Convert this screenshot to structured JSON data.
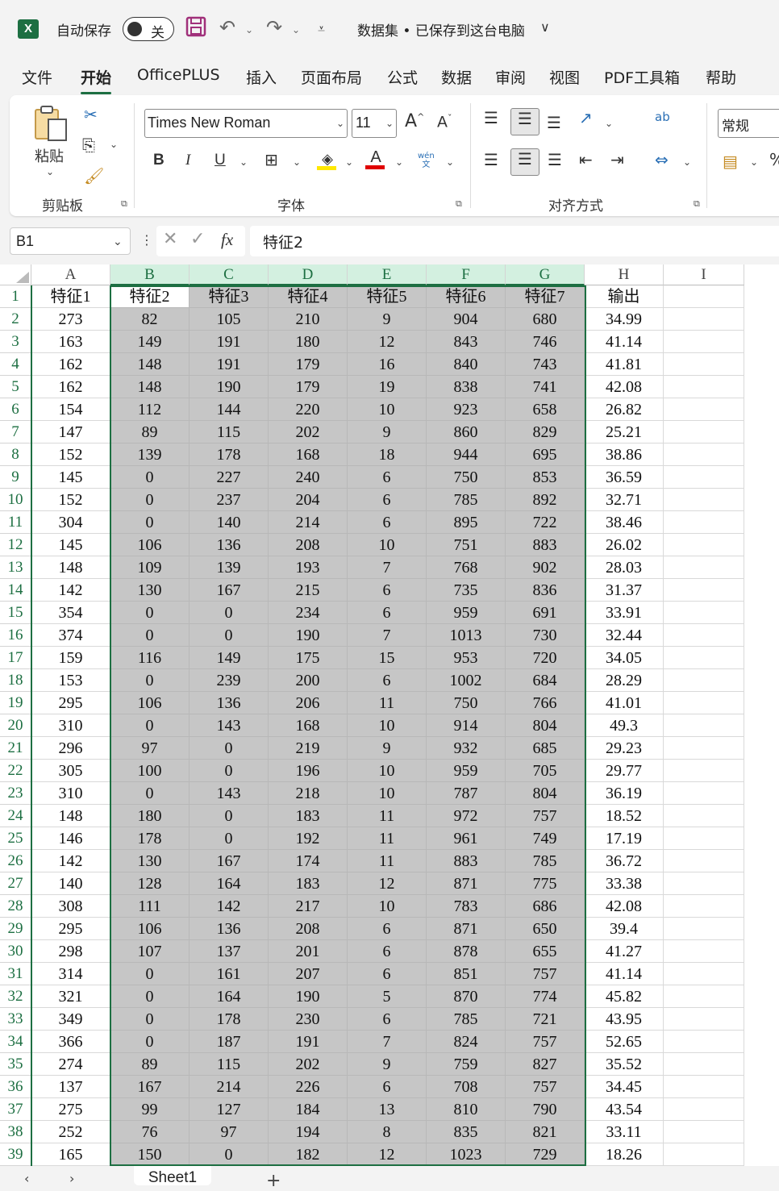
{
  "titlebar": {
    "autosave_label": "自动保存",
    "autosave_state": "关",
    "doc_title": "数据集 • 已保存到这台电脑"
  },
  "menu": {
    "tabs": [
      "文件",
      "开始",
      "OfficePLUS",
      "插入",
      "页面布局",
      "公式",
      "数据",
      "审阅",
      "视图",
      "PDF工具箱",
      "帮助"
    ],
    "active": "开始"
  },
  "ribbon": {
    "clipboard": {
      "paste_label": "粘贴",
      "group_label": "剪贴板"
    },
    "font": {
      "font_name": "Times New Roman",
      "font_size": "11",
      "group_label": "字体",
      "bold": "B",
      "italic": "I",
      "underline": "U",
      "font_color_letter": "A",
      "phonetic_top": "wén",
      "phonetic_bottom": "文"
    },
    "alignment": {
      "group_label": "对齐方式",
      "wrap_icon_text": "ab"
    },
    "number": {
      "format": "常规"
    }
  },
  "formula_bar": {
    "name_box": "B1",
    "fx_label": "fx",
    "formula": "特征2"
  },
  "sheet": {
    "columns": [
      "A",
      "B",
      "C",
      "D",
      "E",
      "F",
      "G",
      "H",
      "I"
    ],
    "selected_columns": [
      "B",
      "C",
      "D",
      "E",
      "F",
      "G"
    ],
    "headers": [
      "特征1",
      "特征2",
      "特征3",
      "特征4",
      "特征5",
      "特征6",
      "特征7",
      "输出"
    ],
    "rows": [
      [
        "273",
        "82",
        "105",
        "210",
        "9",
        "904",
        "680",
        "34.99"
      ],
      [
        "163",
        "149",
        "191",
        "180",
        "12",
        "843",
        "746",
        "41.14"
      ],
      [
        "162",
        "148",
        "191",
        "179",
        "16",
        "840",
        "743",
        "41.81"
      ],
      [
        "162",
        "148",
        "190",
        "179",
        "19",
        "838",
        "741",
        "42.08"
      ],
      [
        "154",
        "112",
        "144",
        "220",
        "10",
        "923",
        "658",
        "26.82"
      ],
      [
        "147",
        "89",
        "115",
        "202",
        "9",
        "860",
        "829",
        "25.21"
      ],
      [
        "152",
        "139",
        "178",
        "168",
        "18",
        "944",
        "695",
        "38.86"
      ],
      [
        "145",
        "0",
        "227",
        "240",
        "6",
        "750",
        "853",
        "36.59"
      ],
      [
        "152",
        "0",
        "237",
        "204",
        "6",
        "785",
        "892",
        "32.71"
      ],
      [
        "304",
        "0",
        "140",
        "214",
        "6",
        "895",
        "722",
        "38.46"
      ],
      [
        "145",
        "106",
        "136",
        "208",
        "10",
        "751",
        "883",
        "26.02"
      ],
      [
        "148",
        "109",
        "139",
        "193",
        "7",
        "768",
        "902",
        "28.03"
      ],
      [
        "142",
        "130",
        "167",
        "215",
        "6",
        "735",
        "836",
        "31.37"
      ],
      [
        "354",
        "0",
        "0",
        "234",
        "6",
        "959",
        "691",
        "33.91"
      ],
      [
        "374",
        "0",
        "0",
        "190",
        "7",
        "1013",
        "730",
        "32.44"
      ],
      [
        "159",
        "116",
        "149",
        "175",
        "15",
        "953",
        "720",
        "34.05"
      ],
      [
        "153",
        "0",
        "239",
        "200",
        "6",
        "1002",
        "684",
        "28.29"
      ],
      [
        "295",
        "106",
        "136",
        "206",
        "11",
        "750",
        "766",
        "41.01"
      ],
      [
        "310",
        "0",
        "143",
        "168",
        "10",
        "914",
        "804",
        "49.3"
      ],
      [
        "296",
        "97",
        "0",
        "219",
        "9",
        "932",
        "685",
        "29.23"
      ],
      [
        "305",
        "100",
        "0",
        "196",
        "10",
        "959",
        "705",
        "29.77"
      ],
      [
        "310",
        "0",
        "143",
        "218",
        "10",
        "787",
        "804",
        "36.19"
      ],
      [
        "148",
        "180",
        "0",
        "183",
        "11",
        "972",
        "757",
        "18.52"
      ],
      [
        "146",
        "178",
        "0",
        "192",
        "11",
        "961",
        "749",
        "17.19"
      ],
      [
        "142",
        "130",
        "167",
        "174",
        "11",
        "883",
        "785",
        "36.72"
      ],
      [
        "140",
        "128",
        "164",
        "183",
        "12",
        "871",
        "775",
        "33.38"
      ],
      [
        "308",
        "111",
        "142",
        "217",
        "10",
        "783",
        "686",
        "42.08"
      ],
      [
        "295",
        "106",
        "136",
        "208",
        "6",
        "871",
        "650",
        "39.4"
      ],
      [
        "298",
        "107",
        "137",
        "201",
        "6",
        "878",
        "655",
        "41.27"
      ],
      [
        "314",
        "0",
        "161",
        "207",
        "6",
        "851",
        "757",
        "41.14"
      ],
      [
        "321",
        "0",
        "164",
        "190",
        "5",
        "870",
        "774",
        "45.82"
      ],
      [
        "349",
        "0",
        "178",
        "230",
        "6",
        "785",
        "721",
        "43.95"
      ],
      [
        "366",
        "0",
        "187",
        "191",
        "7",
        "824",
        "757",
        "52.65"
      ],
      [
        "274",
        "89",
        "115",
        "202",
        "9",
        "759",
        "827",
        "35.52"
      ],
      [
        "137",
        "167",
        "214",
        "226",
        "6",
        "708",
        "757",
        "34.45"
      ],
      [
        "275",
        "99",
        "127",
        "184",
        "13",
        "810",
        "790",
        "43.54"
      ],
      [
        "252",
        "76",
        "97",
        "194",
        "8",
        "835",
        "821",
        "33.11"
      ],
      [
        "165",
        "150",
        "0",
        "182",
        "12",
        "1023",
        "729",
        "18.26"
      ]
    ]
  },
  "sheet_tabs": {
    "active": "Sheet1",
    "add": "+"
  },
  "colors": {
    "accent": "#1d6f42",
    "selection": "#c6c6c6"
  }
}
